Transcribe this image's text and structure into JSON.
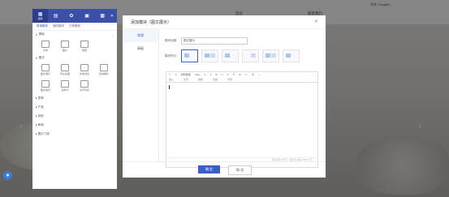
{
  "background": {
    "language_switch": "中文 / English",
    "nav_items": [
      "首页",
      "",
      "",
      "",
      "",
      "联系我们"
    ]
  },
  "panel": {
    "tabs": [
      {
        "label": "组件",
        "icon": "grid-icon"
      },
      {
        "label": "",
        "icon": "layout-icon"
      },
      {
        "label": "",
        "icon": "settings-icon"
      },
      {
        "label": "",
        "icon": "page-icon"
      },
      {
        "label": "",
        "icon": "menu-icon"
      }
    ],
    "subtabs": [
      "常用模块",
      "我的模块",
      "已有模块"
    ],
    "section_basic": "基础",
    "basic_items": [
      "文本",
      "图片",
      "按钮"
    ],
    "section_pictext": "图文",
    "pictext_items": [
      "图文展示",
      "列表多图",
      "文本列表",
      "自动展示",
      "图文组合",
      "选项卡",
      "文字列表"
    ],
    "sections": [
      "表单",
      "产品",
      "其他",
      "新闻",
      "图片门类"
    ]
  },
  "dialog": {
    "title": "添加模块（图文展示）",
    "side_items": [
      "常规",
      "高级"
    ],
    "module_name_label": "模块标题：",
    "module_name_value": "图文展示",
    "module_style_label": "模块样式：",
    "toolbar_row1": [
      "↶",
      "⎘",
      "微软雅黑",
      "14px",
      "A",
      "A",
      "B",
      "U",
      "≡",
      "☰",
      "⊞",
      "▭",
      "🔗",
      "⌗"
    ],
    "toolbar_row2": [
      "插入",
      "文字",
      "排版",
      "表格",
      "代码"
    ],
    "editor_footer": "当前已输入0个字，您还可以输入10000个字。",
    "ok_label": "确 定",
    "cancel_label": "取 消"
  }
}
